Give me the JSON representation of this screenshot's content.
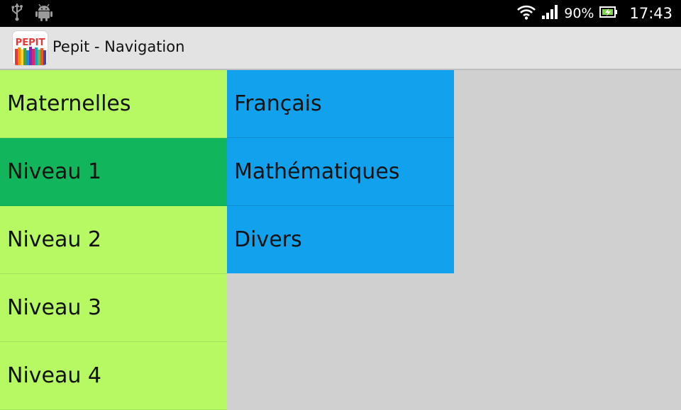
{
  "status_bar": {
    "icons": [
      "usb-icon",
      "android-debug-icon",
      "wifi-icon",
      "signal-icon",
      "battery-charging-icon"
    ],
    "battery": "90%",
    "time": "17:43"
  },
  "action_bar": {
    "icon_text": "PEPIT",
    "title": "Pepit - Navigation"
  },
  "levels": {
    "selected_index": 1,
    "items": [
      "Maternelles",
      "Niveau 1",
      "Niveau 2",
      "Niveau 3",
      "Niveau 4"
    ]
  },
  "subjects": {
    "items": [
      "Français",
      "Mathématiques",
      "Divers"
    ]
  },
  "colors": {
    "level_bg": "#b7f963",
    "level_selected_bg": "#11b55b",
    "subject_bg": "#12a1ec",
    "background": "#d0d0d0"
  }
}
